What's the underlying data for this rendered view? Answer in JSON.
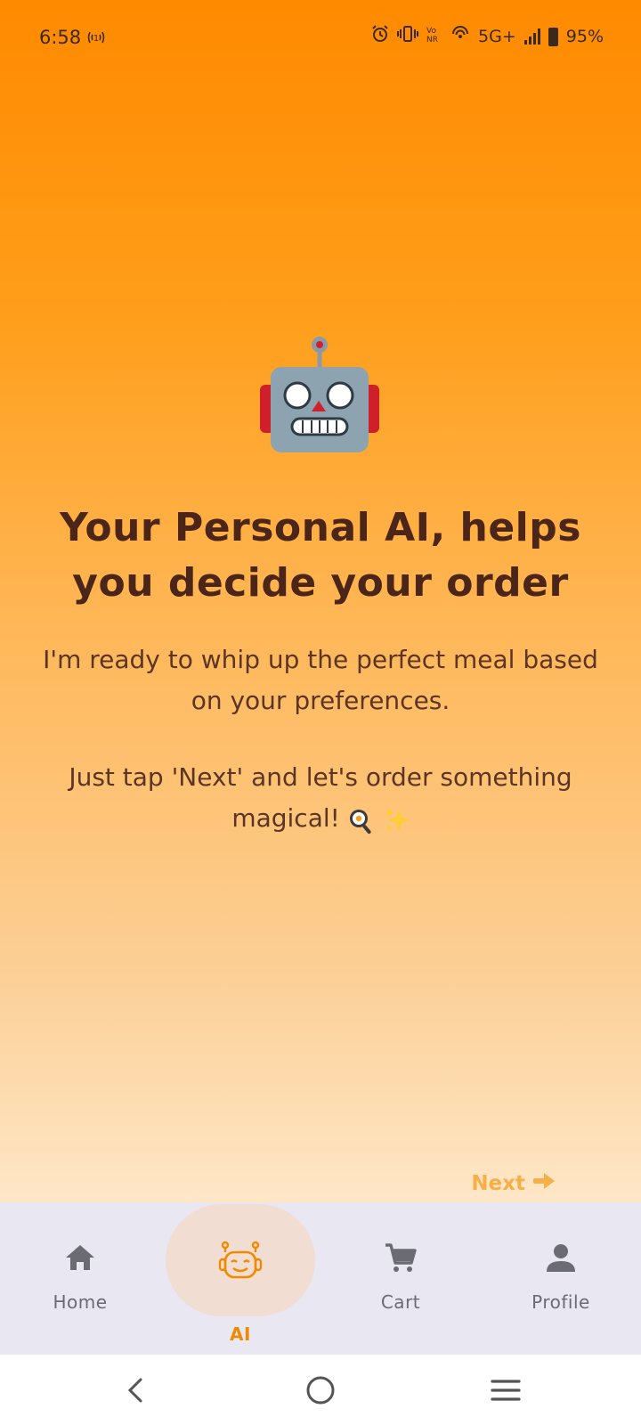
{
  "status_bar": {
    "time": "6:58",
    "network": "5G+",
    "battery": "95%",
    "icons": [
      "hotspot-icon",
      "alarm-icon",
      "vibrate-icon",
      "volte-icon",
      "wifi-calling-icon",
      "signal-icon",
      "battery-icon"
    ]
  },
  "hero": {
    "illustration": "robot-face-emoji",
    "headline": "Your Personal AI, helps you decide your order",
    "subtext": "I'm ready to whip up the perfect meal based on your preferences.",
    "subtext2": "Just tap 'Next' and let's order something magical!",
    "subtext2_emojis": [
      "cooking-emoji",
      "sparkles-emoji"
    ]
  },
  "next_button": {
    "label": "Next",
    "icon": "arrow-right-icon"
  },
  "bottom_nav": {
    "items": [
      {
        "label": "Home",
        "icon": "home-icon",
        "active": false
      },
      {
        "label": "AI",
        "icon": "ai-bot-icon",
        "active": true
      },
      {
        "label": "Cart",
        "icon": "cart-icon",
        "active": false
      },
      {
        "label": "Profile",
        "icon": "profile-icon",
        "active": false
      }
    ],
    "active_color": "#f08a00",
    "inactive_color": "#6b6b73"
  },
  "system_nav": {
    "buttons": [
      "back-icon",
      "home-circle-icon",
      "recents-icon"
    ]
  },
  "colors": {
    "gradient_top": "#ff8a00",
    "gradient_bottom": "#ffefdc",
    "headline": "#4a2518",
    "next": "#f6b047"
  }
}
